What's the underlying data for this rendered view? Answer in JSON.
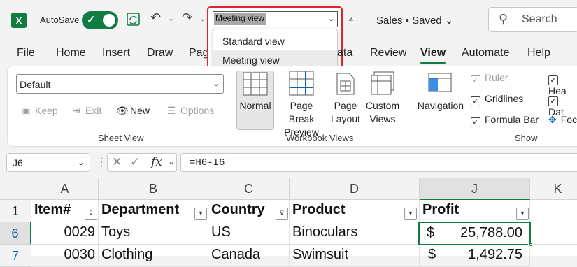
{
  "titlebar": {
    "autosave_label": "AutoSave",
    "doc_title": "Sales • Saved",
    "search_placeholder": "Search"
  },
  "view_dropdown": {
    "selected": "Meeting view",
    "options": [
      "Standard view",
      "Meeting view"
    ]
  },
  "tabs": [
    "File",
    "Home",
    "Insert",
    "Draw",
    "Page",
    "Data",
    "Review",
    "View",
    "Automate",
    "Help"
  ],
  "active_tab": "View",
  "ribbon": {
    "sheet_view": {
      "select_value": "Default",
      "keep": "Keep",
      "exit": "Exit",
      "new": "New",
      "options": "Options",
      "group_label": "Sheet View"
    },
    "workbook_views": {
      "normal": "Normal",
      "page_break_1": "Page Break",
      "page_break_2": "Preview",
      "page_layout_1": "Page",
      "page_layout_2": "Layout",
      "custom_1": "Custom",
      "custom_2": "Views",
      "group_label": "Workbook Views"
    },
    "show": {
      "navigation": "Navigation",
      "ruler": "Ruler",
      "gridlines": "Gridlines",
      "formula_bar": "Formula Bar",
      "headings": "Hea",
      "data": "Dat",
      "focus": "Foc",
      "group_label": "Show"
    }
  },
  "formula_bar": {
    "name_box": "J6",
    "formula": "=H6-I6"
  },
  "sheet": {
    "columns": [
      "A",
      "B",
      "C",
      "D",
      "J",
      "K"
    ],
    "rows": [
      "1",
      "6",
      "7"
    ],
    "header_row": [
      "Item#",
      "Department",
      "Country",
      "Product",
      "Profit"
    ],
    "row6": [
      "0029",
      "Toys",
      "US",
      "Binoculars",
      "$",
      "25,788.00"
    ],
    "row7": [
      "0030",
      "Clothing",
      "Canada",
      "Swimsuit",
      "$",
      "1,492.75"
    ]
  }
}
